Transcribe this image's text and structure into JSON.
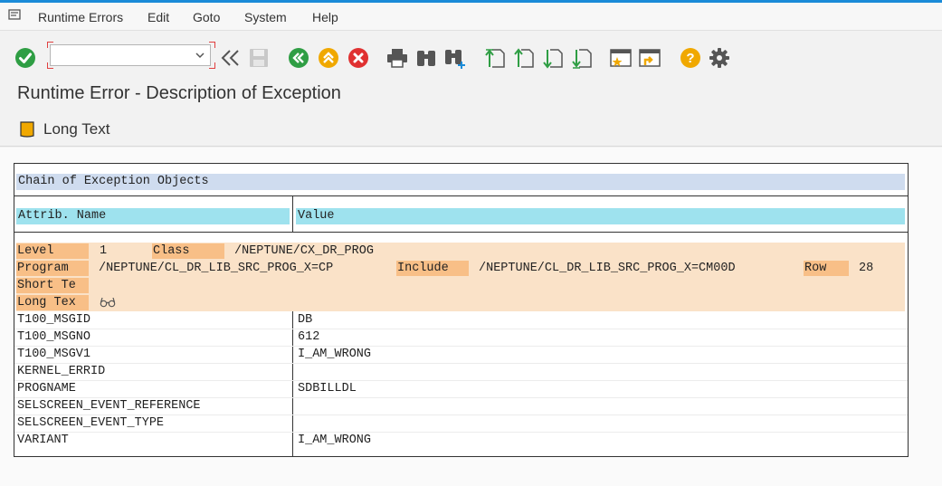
{
  "menu": {
    "items": [
      "Runtime Errors",
      "Edit",
      "Goto",
      "System",
      "Help"
    ]
  },
  "toolbar": {
    "command_field_value": "",
    "icons": [
      "enter-icon",
      "back-icon",
      "save-icon",
      "back-green-icon",
      "exit-icon",
      "cancel-icon",
      "print-icon",
      "find-icon",
      "find-next-icon",
      "first-page-icon",
      "previous-page-icon",
      "next-page-icon",
      "last-page-icon",
      "create-session-icon",
      "shortcut-icon",
      "help-icon",
      "settings-icon"
    ]
  },
  "page": {
    "title": "Runtime Error - Description of Exception"
  },
  "app_toolbar": {
    "long_text_label": "Long Text"
  },
  "chain": {
    "title": "Chain of Exception Objects",
    "col_attr": "Attrib. Name",
    "col_value": "Value",
    "level_label": "Level",
    "level_value": "1",
    "class_label": "Class",
    "class_value": "/NEPTUNE/CX_DR_PROG",
    "program_label": "Program",
    "program_value": "/NEPTUNE/CL_DR_LIB_SRC_PROG_X=CP",
    "include_label": "Include",
    "include_value": "/NEPTUNE/CL_DR_LIB_SRC_PROG_X=CM00D",
    "row_label": "Row",
    "row_value": "28",
    "short_text_label": "Short Te",
    "long_text_label": "Long Tex",
    "rows": [
      {
        "name": "T100_MSGID",
        "value": "DB"
      },
      {
        "name": "T100_MSGNO",
        "value": "612"
      },
      {
        "name": "T100_MSGV1",
        "value": "I_AM_WRONG"
      },
      {
        "name": "KERNEL_ERRID",
        "value": ""
      },
      {
        "name": "PROGNAME",
        "value": "SDBILLDL"
      },
      {
        "name": "SELSCREEN_EVENT_REFERENCE",
        "value": ""
      },
      {
        "name": "SELSCREEN_EVENT_TYPE",
        "value": ""
      },
      {
        "name": "VARIANT",
        "value": "I_AM_WRONG"
      }
    ]
  },
  "colors": {
    "title_band": "#cfdcef",
    "header_cells": "#9ee2ee",
    "info_block": "#fae2c8",
    "info_labels": "#f8bf87",
    "accent_blue": "#1a8bd8"
  }
}
